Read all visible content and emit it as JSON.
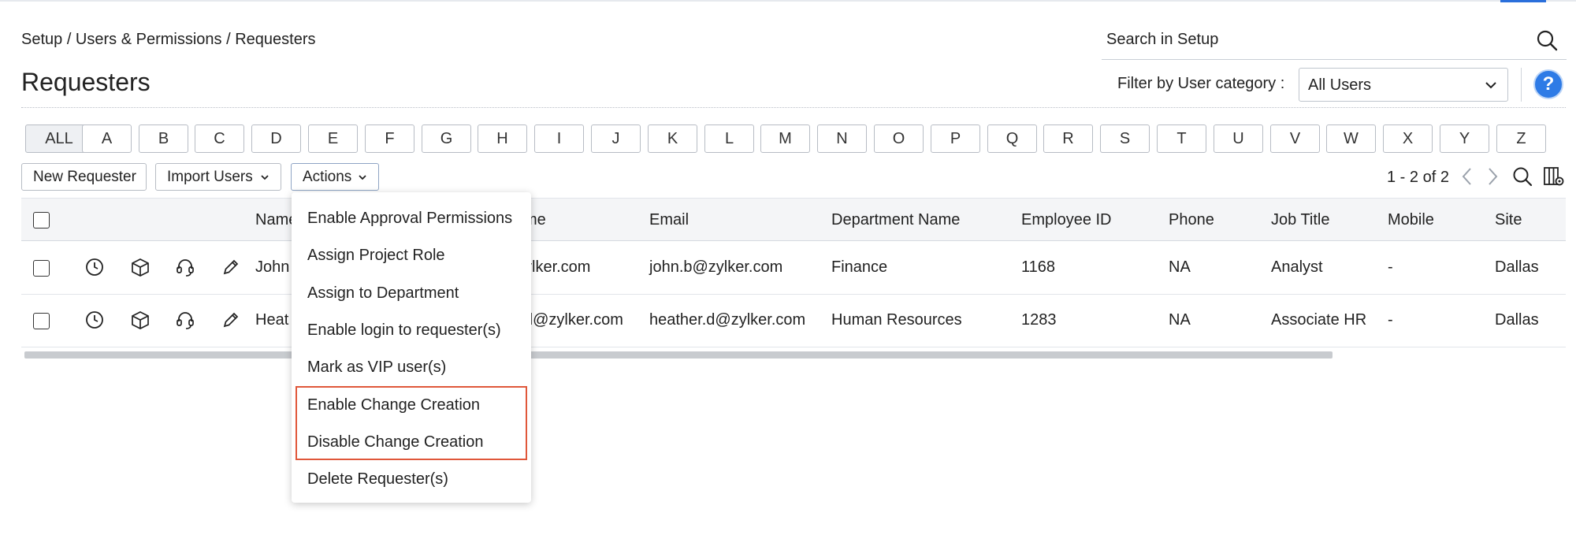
{
  "breadcrumb": "Setup / Users & Permissions / Requesters",
  "page_title": "Requesters",
  "search": {
    "placeholder": "Search in Setup",
    "icon": "search-icon"
  },
  "filter": {
    "label": "Filter by User category :",
    "selected": "All Users"
  },
  "help_label": "?",
  "alphabet": [
    "ALL",
    "A",
    "B",
    "C",
    "D",
    "E",
    "F",
    "G",
    "H",
    "I",
    "J",
    "K",
    "L",
    "M",
    "N",
    "O",
    "P",
    "Q",
    "R",
    "S",
    "T",
    "U",
    "V",
    "W",
    "X",
    "Y",
    "Z"
  ],
  "toolbar": {
    "new_requester": "New Requester",
    "import_users": "Import Users",
    "actions": "Actions"
  },
  "pager": {
    "text": "1 - 2 of 2"
  },
  "columns": {
    "name": "Name",
    "login_name_tail": "me",
    "email": "Email",
    "department": "Department Name",
    "employee_id": "Employee ID",
    "phone": "Phone",
    "job_title": "Job Title",
    "mobile": "Mobile",
    "site": "Site"
  },
  "rows": [
    {
      "name": "John",
      "login_tail": "ylker.com",
      "email": "john.b@zylker.com",
      "department": "Finance",
      "employee_id": "1168",
      "phone": "NA",
      "job_title": "Analyst",
      "mobile": "-",
      "site": "Dallas"
    },
    {
      "name": "Heat",
      "login_tail": "d@zylker.com",
      "email": "heather.d@zylker.com",
      "department": "Human Resources",
      "employee_id": "1283",
      "phone": "NA",
      "job_title": "Associate HR",
      "mobile": "-",
      "site": "Dallas"
    }
  ],
  "actions_menu": [
    "Enable Approval Permissions",
    "Assign Project Role",
    "Assign to Department",
    "Enable login to requester(s)",
    "Mark as VIP user(s)",
    "Enable Change Creation",
    "Disable Change Creation",
    "Delete Requester(s)"
  ],
  "colors": {
    "accent": "#2e7be6",
    "highlight": "#e0573a"
  }
}
